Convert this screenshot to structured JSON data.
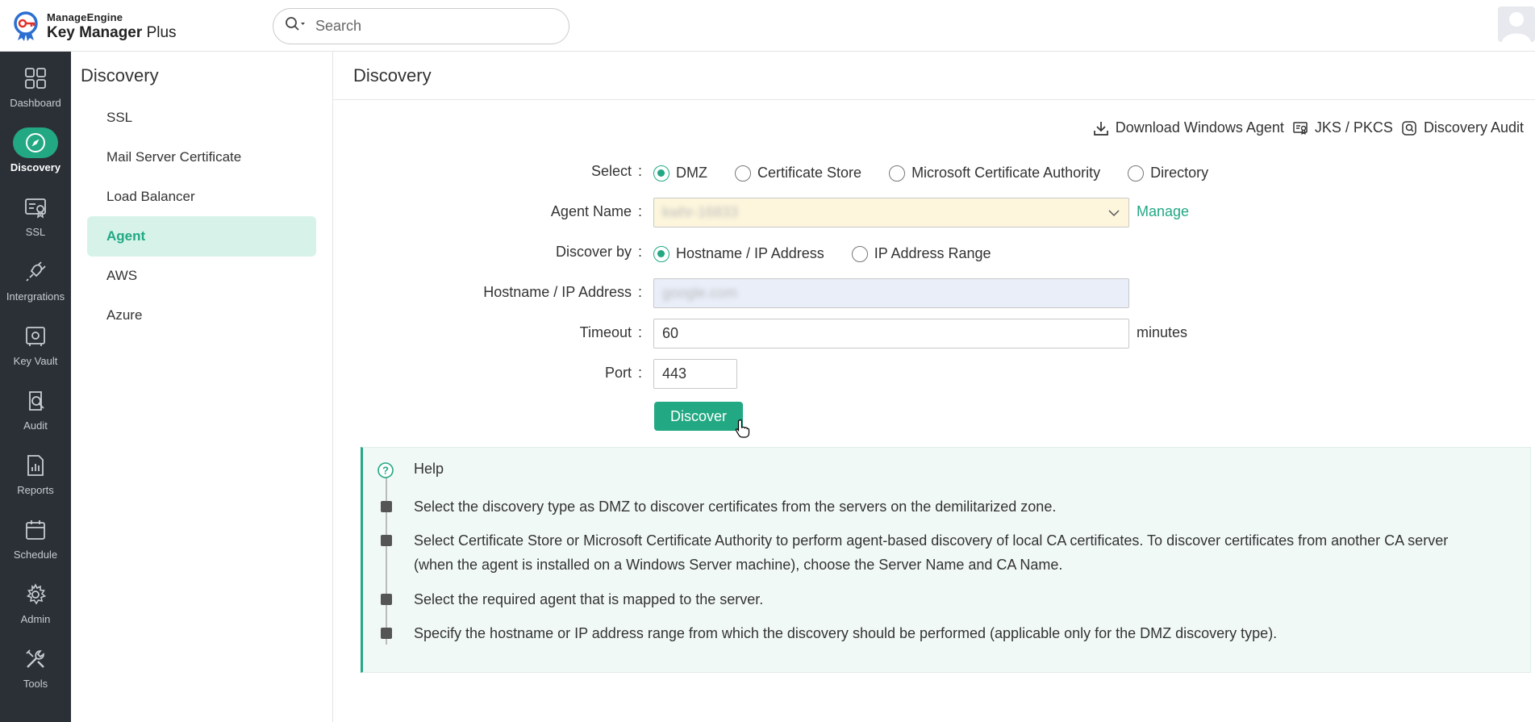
{
  "brand": {
    "company": "ManageEngine",
    "product": "Key Manager",
    "product_suffix": "Plus"
  },
  "search": {
    "placeholder": "Search"
  },
  "leftnav": [
    {
      "label": "Dashboard",
      "icon": "dashboard-icon"
    },
    {
      "label": "Discovery",
      "icon": "compass-icon",
      "active": true
    },
    {
      "label": "SSL",
      "icon": "certificate-icon"
    },
    {
      "label": "Intergrations",
      "icon": "plug-icon"
    },
    {
      "label": "Key Vault",
      "icon": "vault-icon"
    },
    {
      "label": "Audit",
      "icon": "audit-icon"
    },
    {
      "label": "Reports",
      "icon": "reports-icon"
    },
    {
      "label": "Schedule",
      "icon": "calendar-icon"
    },
    {
      "label": "Admin",
      "icon": "gear-icon"
    },
    {
      "label": "Tools",
      "icon": "tools-icon"
    }
  ],
  "subnav": {
    "title": "Discovery",
    "items": [
      {
        "label": "SSL"
      },
      {
        "label": "Mail Server Certificate"
      },
      {
        "label": "Load Balancer"
      },
      {
        "label": "Agent",
        "active": true
      },
      {
        "label": "AWS"
      },
      {
        "label": "Azure"
      }
    ]
  },
  "main": {
    "title": "Discovery",
    "actions": {
      "download": "Download Windows Agent",
      "jks": "JKS / PKCS",
      "audit": "Discovery Audit"
    },
    "form": {
      "select_label": "Select",
      "select_options": [
        "DMZ",
        "Certificate Store",
        "Microsoft Certificate Authority",
        "Directory"
      ],
      "select_value": "DMZ",
      "agent_label": "Agent Name",
      "agent_value": "kwhr-16833",
      "manage_link": "Manage",
      "discover_by_label": "Discover by",
      "discover_by_options": [
        "Hostname / IP Address",
        "IP Address Range"
      ],
      "discover_by_value": "Hostname / IP Address",
      "host_label": "Hostname / IP Address",
      "host_value": "google.com",
      "timeout_label": "Timeout",
      "timeout_value": "60",
      "timeout_unit": "minutes",
      "port_label": "Port",
      "port_value": "443",
      "discover_button": "Discover"
    },
    "help": {
      "title": "Help",
      "items": [
        "Select the discovery type as DMZ to discover certificates from the servers on the demilitarized zone.",
        "Select Certificate Store or Microsoft Certificate Authority to perform agent-based discovery of local CA certificates. To discover certificates from another CA server (when the agent is installed on a Windows Server machine), choose the Server Name and CA Name.",
        "Select the required agent that is mapped to the server.",
        "Specify the hostname or IP address range from which the discovery should be performed (applicable only for the DMZ discovery type)."
      ]
    }
  },
  "colors": {
    "accent": "#22a883",
    "nav_bg": "#2b2f36",
    "help_bg": "#f1f9f7"
  }
}
